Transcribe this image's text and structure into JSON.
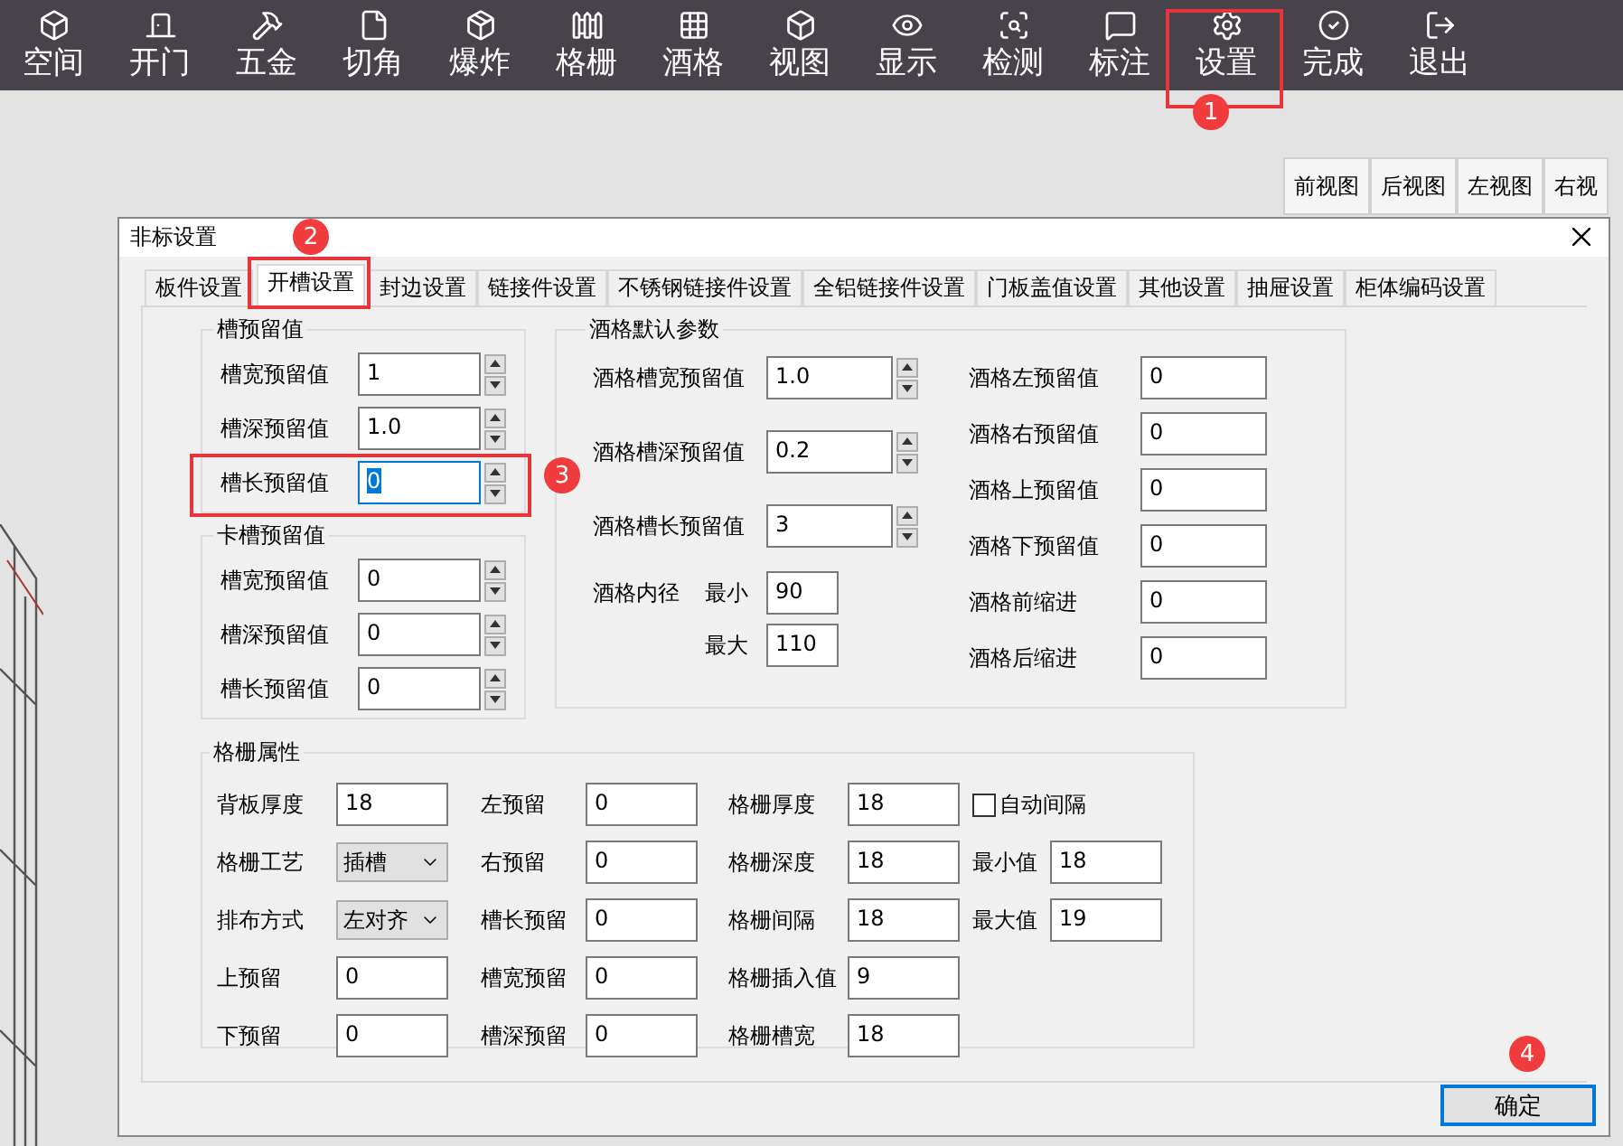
{
  "toolbar": {
    "items": [
      {
        "label": "空间"
      },
      {
        "label": "开门"
      },
      {
        "label": "五金"
      },
      {
        "label": "切角"
      },
      {
        "label": "爆炸"
      },
      {
        "label": "格栅"
      },
      {
        "label": "酒格"
      },
      {
        "label": "视图"
      },
      {
        "label": "显示"
      },
      {
        "label": "检测"
      },
      {
        "label": "标注"
      },
      {
        "label": "设置"
      },
      {
        "label": "完成"
      },
      {
        "label": "退出"
      }
    ]
  },
  "view_buttons": [
    "前视图",
    "后视图",
    "左视图",
    "右视"
  ],
  "dialog": {
    "title": "非标设置",
    "tabs": [
      {
        "label": "板件设置",
        "selected": false
      },
      {
        "label": "开槽设置",
        "selected": true
      },
      {
        "label": "封边设置",
        "selected": false
      },
      {
        "label": "链接件设置",
        "selected": false
      },
      {
        "label": "不锈钢链接件设置",
        "selected": false
      },
      {
        "label": "全铝链接件设置",
        "selected": false
      },
      {
        "label": "门板盖值设置",
        "selected": false
      },
      {
        "label": "其他设置",
        "selected": false
      },
      {
        "label": "抽屉设置",
        "selected": false
      },
      {
        "label": "柜体编码设置",
        "selected": false
      }
    ],
    "slot_reserve": {
      "title": "槽预留值",
      "fields": [
        {
          "label": "槽宽预留值",
          "value": "1",
          "focused": false
        },
        {
          "label": "槽深预留值",
          "value": "1.0",
          "focused": false
        },
        {
          "label": "槽长预留值",
          "value": "0",
          "focused": true
        }
      ]
    },
    "card_slot_reserve": {
      "title": "卡槽预留值",
      "fields": [
        {
          "label": "槽宽预留值",
          "value": "0",
          "focused": false
        },
        {
          "label": "槽深预留值",
          "value": "0",
          "focused": false
        },
        {
          "label": "槽长预留值",
          "value": "0",
          "focused": false
        }
      ]
    },
    "wine_defaults": {
      "title": "酒格默认参数",
      "spin_fields": [
        {
          "label": "酒格槽宽预留值",
          "value": "1.0"
        },
        {
          "label": "酒格槽深预留值",
          "value": "0.2"
        },
        {
          "label": "酒格槽长预留值",
          "value": "3"
        }
      ],
      "inner_diameter": {
        "label": "酒格内径",
        "min_label": "最小",
        "min_value": "90",
        "max_label": "最大",
        "max_value": "110"
      },
      "fields": [
        {
          "label": "酒格左预留值",
          "value": "0"
        },
        {
          "label": "酒格右预留值",
          "value": "0"
        },
        {
          "label": "酒格上预留值",
          "value": "0"
        },
        {
          "label": "酒格下预留值",
          "value": "0"
        },
        {
          "label": "酒格前缩进",
          "value": "0"
        },
        {
          "label": "酒格后缩进",
          "value": "0"
        }
      ]
    },
    "grille": {
      "title": "格栅属性",
      "rows": [
        [
          {
            "kind": "input",
            "label": "背板厚度",
            "value": "18"
          },
          {
            "kind": "input",
            "label": "左预留",
            "value": "0"
          },
          {
            "kind": "input",
            "label": "格栅厚度",
            "value": "18"
          },
          {
            "kind": "checkbox",
            "label": "自动间隔",
            "checked": false
          }
        ],
        [
          {
            "kind": "select",
            "label": "格栅工艺",
            "value": "插槽"
          },
          {
            "kind": "input",
            "label": "右预留",
            "value": "0"
          },
          {
            "kind": "input",
            "label": "格栅深度",
            "value": "18"
          },
          {
            "kind": "input",
            "label": "最小值",
            "value": "18"
          }
        ],
        [
          {
            "kind": "select",
            "label": "排布方式",
            "value": "左对齐"
          },
          {
            "kind": "input",
            "label": "槽长预留",
            "value": "0"
          },
          {
            "kind": "input",
            "label": "格栅间隔",
            "value": "18"
          },
          {
            "kind": "input",
            "label": "最大值",
            "value": "19"
          }
        ],
        [
          {
            "kind": "input",
            "label": "上预留",
            "value": "0"
          },
          {
            "kind": "input",
            "label": "槽宽预留",
            "value": "0"
          },
          {
            "kind": "input",
            "label": "格栅插入值",
            "value": "9"
          }
        ],
        [
          {
            "kind": "input",
            "label": "下预留",
            "value": "0"
          },
          {
            "kind": "input",
            "label": "槽深预留",
            "value": "0"
          },
          {
            "kind": "input",
            "label": "格栅槽宽",
            "value": "18"
          }
        ]
      ]
    },
    "ok_button": "确定"
  },
  "annotations": [
    "1",
    "2",
    "3",
    "4"
  ]
}
